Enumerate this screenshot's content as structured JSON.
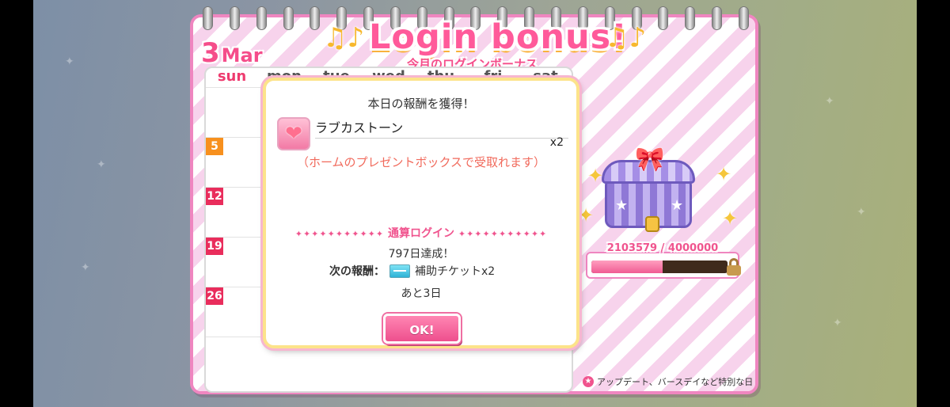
{
  "header": {
    "date_day": "3",
    "date_month": "Mar",
    "title": "Login bonus!",
    "subtitle": "今月のログインボーナス",
    "note_left": "♫♪",
    "note_right": "♫♪"
  },
  "calendar": {
    "weekdays": [
      "sun",
      "mon",
      "tue",
      "wed",
      "thu",
      "fri",
      "sat"
    ],
    "sunday_dates": [
      "5",
      "12",
      "19",
      "26"
    ],
    "legend_text": "アップデート、バースデイなど特別な日"
  },
  "treasure": {
    "progress_label": "2103579 / 4000000",
    "progress_current": 2103579,
    "progress_total": 4000000
  },
  "dialog": {
    "title": "本日の報酬を獲得！",
    "reward_name": "ラブカストーン",
    "reward_qty": "x2",
    "reward_note": "（ホームのプレゼントボックスで受取れます）",
    "cumulative_title": "通算ログイン",
    "dots": "✦✦✦✦✦✦✦✦✦✦✦",
    "days_achieved": "797日達成！",
    "next_reward_label": "次の報酬：",
    "next_reward_item": "補助チケットx2",
    "remaining": "あと3日",
    "ok_label": "OK!"
  },
  "colors": {
    "accent_pink": "#f0548e",
    "calendar_border": "#ef86c0",
    "dialog_border": "#fce38a"
  }
}
